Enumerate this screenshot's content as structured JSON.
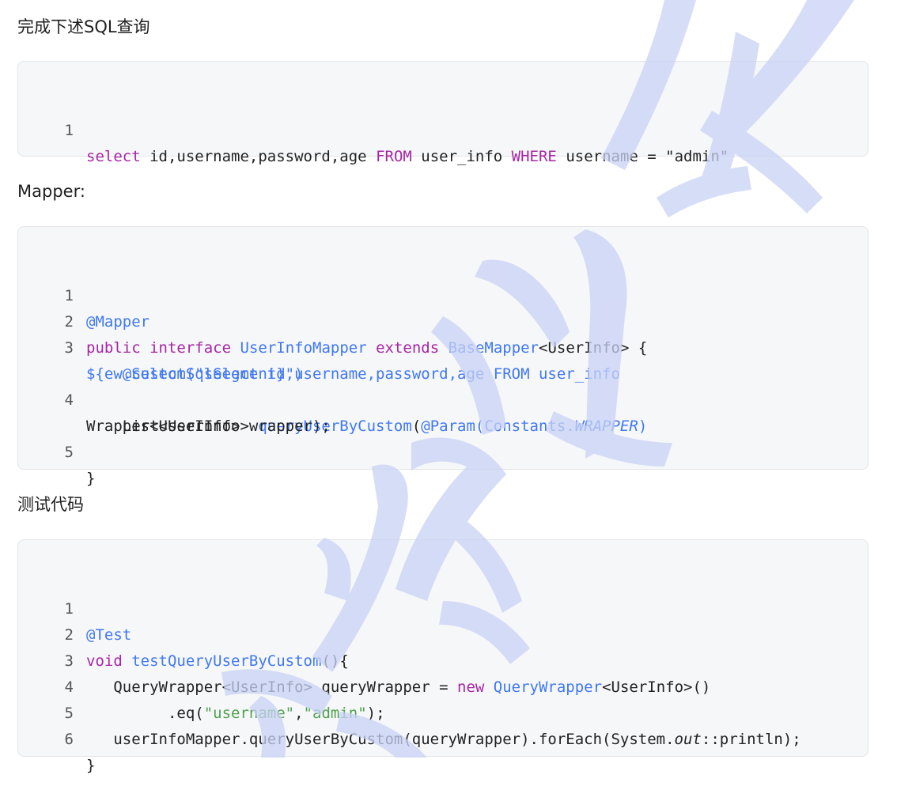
{
  "section1": {
    "heading": "完成下述SQL查询",
    "code": {
      "n1": "1",
      "l1_a": "select",
      "l1_b": " id,username,password,age ",
      "l1_c": "FROM",
      "l1_d": " user_info ",
      "l1_e": "WHERE",
      "l1_f": " username = \"admin\""
    }
  },
  "section2": {
    "heading": "Mapper:",
    "code": {
      "n1": "1",
      "n2": "2",
      "n3": "3",
      "n4": "4",
      "n5": "5",
      "l1_a": "@Mapper",
      "l2_a": "public",
      "l2_b": " ",
      "l2_c": "interface",
      "l2_d": " ",
      "l2_e": "UserInfoMapper",
      "l2_f": " ",
      "l2_g": "extends",
      "l2_h": " ",
      "l2_i": "BaseMapper",
      "l2_j": "<UserInfo> {",
      "l3_a": "    ",
      "l3_b": "@Select(\"select id,username,password,age FROM user_info",
      "l3c_a": "${ew.customSqlSegment}\")",
      "l4_a": "    List<UserInfo> ",
      "l4_b": "queryUserByCustom",
      "l4_c": "(",
      "l4_d": "@Param(Constants.",
      "l4_e": "WRAPPER",
      "l4_f": ")",
      "l4c_a": "Wrapper<UserInfo> wrapper);",
      "l5_a": "}"
    }
  },
  "section3": {
    "heading": "测试代码",
    "code": {
      "n1": "1",
      "n2": "2",
      "n3": "3",
      "n4": "4",
      "n5": "5",
      "n6": "6",
      "l1_a": "@Test",
      "l2_a": "void",
      "l2_b": " ",
      "l2_c": "testQueryUserByCustom",
      "l2_d": "(){",
      "l3_a": "   QueryWrapper<UserInfo> queryWrapper = ",
      "l3_b": "new",
      "l3_c": " ",
      "l3_d": "QueryWrapper",
      "l3_e": "<UserInfo>()",
      "l4_a": "         .eq(",
      "l4_b": "\"username\"",
      "l4_c": ",",
      "l4_d": "\"admin\"",
      "l4_e": ");",
      "l5_a": "   userInfoMapper.queryUserByCustom(queryWrapper).forEach(System.",
      "l5_b": "out",
      "l5_c": "::println);",
      "l6_a": "}"
    }
  },
  "colors": {
    "keyword": "#a626a4",
    "annotation": "#4078f2",
    "type": "#4078f2",
    "string": "#50a14f",
    "watermark": "#c9d2f5",
    "code_background": "#f6f7f9"
  }
}
